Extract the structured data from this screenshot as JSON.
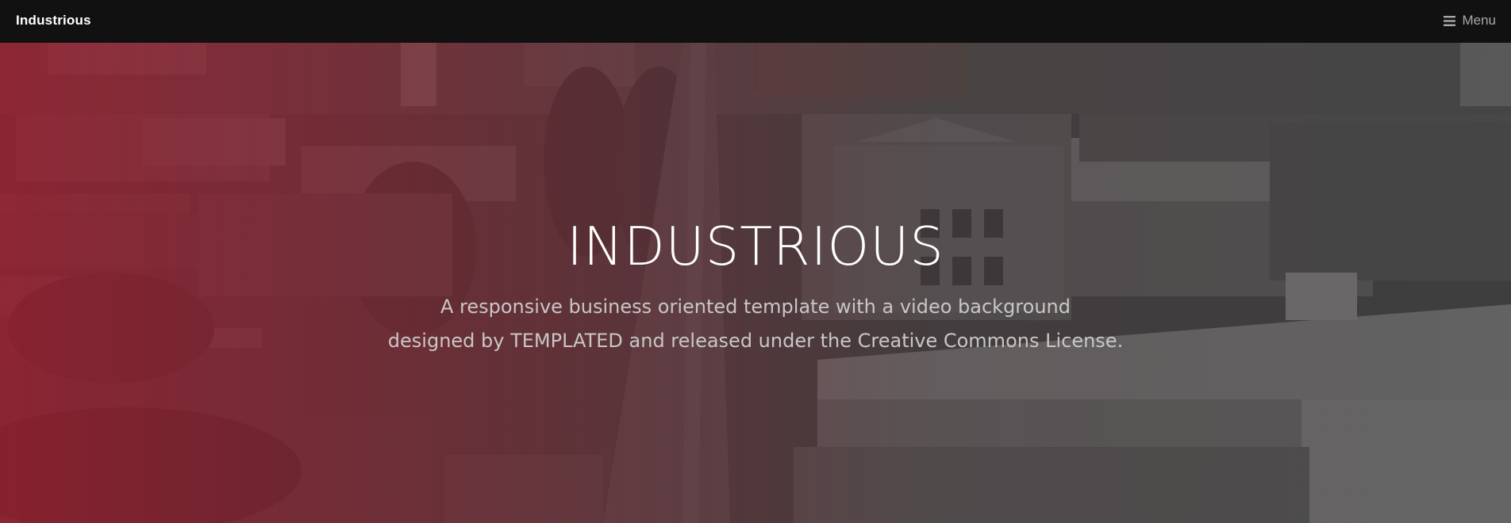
{
  "header": {
    "logo": "Industrious",
    "menu_label": "Menu",
    "menu_icon": "hamburger-icon"
  },
  "banner": {
    "title": "INDUSTRIOUS",
    "subtitle_line1": "A responsive business oriented template with a video background",
    "subtitle_line2": "designed by TEMPLATED and released under the Creative Commons License.",
    "background": "aerial city video still",
    "overlay_colors": [
      "#9c1c2e",
      "#282828"
    ]
  }
}
